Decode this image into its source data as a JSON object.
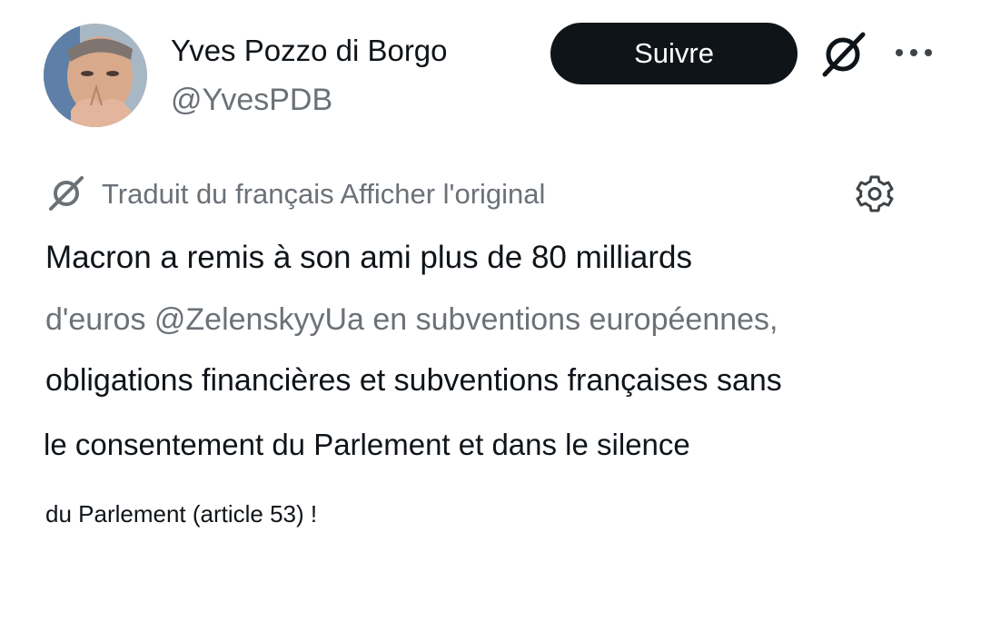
{
  "author": {
    "display_name": "Yves Pozzo di Borgo",
    "handle": "@YvesPDB"
  },
  "actions": {
    "follow_label": "Suivre",
    "grok_icon": "grok-icon",
    "more_icon": "more-icon"
  },
  "translation": {
    "icon": "translate-icon",
    "label": "Traduit du français",
    "link": "Afficher l'original",
    "settings_icon": "gear-icon"
  },
  "tweet": {
    "lines": [
      "Macron a remis à son ami plus de 80 milliards",
      "d'euros @ZelenskyyUa en subventions européennes,",
      "obligations financières et subventions françaises sans",
      "le consentement du Parlement et dans le silence",
      "du Parlement (article 53) !"
    ]
  },
  "colors": {
    "text_primary": "#0f1419",
    "text_secondary": "#6b7177",
    "button_bg": "#0f1419",
    "button_text": "#ffffff"
  }
}
